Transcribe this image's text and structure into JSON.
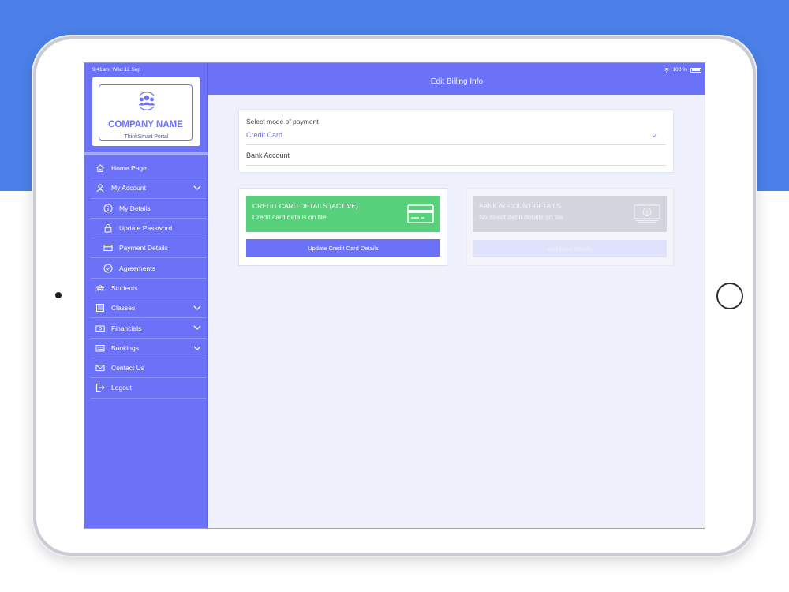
{
  "status_bar": {
    "time": "9:41am",
    "date": "Wed 12 Sep",
    "battery": "100 %"
  },
  "logo": {
    "company_name": "COMPANY NAME",
    "portal_name": "ThinkSmart Portal"
  },
  "header": {
    "title": "Edit Billing Info"
  },
  "sidebar": {
    "items": [
      {
        "label": "Home Page",
        "icon": "home-icon"
      },
      {
        "label": "My Account",
        "icon": "user-icon",
        "expandable": true
      },
      {
        "label": "My Details",
        "icon": "info-icon",
        "sub": true
      },
      {
        "label": "Update Password",
        "icon": "lock-icon",
        "sub": true
      },
      {
        "label": "Payment Details",
        "icon": "card-icon",
        "sub": true
      },
      {
        "label": "Agreements",
        "icon": "check-circle-icon",
        "sub": true
      },
      {
        "label": "Students",
        "icon": "group-icon"
      },
      {
        "label": "Classes",
        "icon": "list-icon",
        "expandable": true
      },
      {
        "label": "Financials",
        "icon": "money-icon",
        "expandable": true
      },
      {
        "label": "Bookings",
        "icon": "bookings-icon",
        "expandable": true
      },
      {
        "label": "Contact Us",
        "icon": "mail-icon"
      },
      {
        "label": "Logout",
        "icon": "logout-icon"
      }
    ]
  },
  "payment_mode": {
    "label": "Select mode of payment",
    "options": [
      {
        "label": "Credit Card",
        "selected": true
      },
      {
        "label": "Bank Account",
        "selected": false
      }
    ]
  },
  "credit_card_card": {
    "title": "CREDIT CARD DETAILS (ACTIVE)",
    "subtitle": "Credit card details on file",
    "button_label": "Update Credit Card Details"
  },
  "bank_card": {
    "title": "BANK ACCOUNT DETAILS",
    "subtitle": "No direct debit details on file.",
    "button_label": "Add Bank Details"
  },
  "colors": {
    "primary": "#6c72f7",
    "success": "#58d17c",
    "background_top": "#4a80e8",
    "disabled": "#d4d5dd"
  }
}
